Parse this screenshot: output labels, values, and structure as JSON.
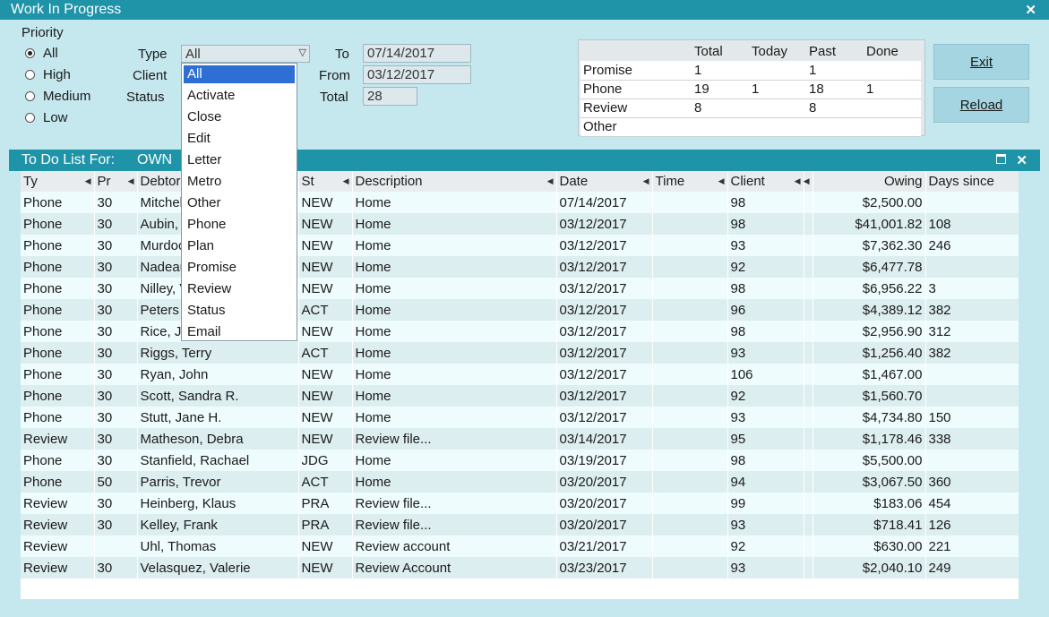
{
  "window": {
    "title": "Work In Progress",
    "close": "✕"
  },
  "filters": {
    "priority_label": "Priority",
    "priorities": [
      {
        "label": "All",
        "selected": true
      },
      {
        "label": "High",
        "selected": false
      },
      {
        "label": "Medium",
        "selected": false
      },
      {
        "label": "Low",
        "selected": false
      }
    ],
    "type_label": "Type",
    "type_value": "All",
    "client_label": "Client",
    "status_label": "Status",
    "to_label": "To",
    "to_value": "07/14/2017",
    "from_label": "From",
    "from_value": "03/12/2017",
    "total_label": "Total",
    "total_value": "28"
  },
  "type_dropdown": {
    "options": [
      "All",
      "Activate",
      "Close",
      "Edit",
      "Letter",
      "Metro",
      "Other",
      "Phone",
      "Plan",
      "Promise",
      "Review",
      "Status",
      "Email"
    ],
    "selected": "All"
  },
  "summary": {
    "headers": [
      "",
      "Total",
      "Today",
      "Past",
      "Done"
    ],
    "rows": [
      [
        "Promise",
        "1",
        "",
        "1",
        ""
      ],
      [
        "Phone",
        "19",
        "1",
        "18",
        "1"
      ],
      [
        "Review",
        "8",
        "",
        "8",
        ""
      ],
      [
        "Other",
        "",
        "",
        "",
        ""
      ]
    ]
  },
  "buttons": {
    "exit": "Exit",
    "reload": "Reload"
  },
  "todo": {
    "title": "To Do List For:",
    "owner": "OWN",
    "columns": [
      "Ty",
      "Pr",
      "Debtor",
      "St",
      "Description",
      "Date",
      "Time",
      "Client",
      "",
      "Owing",
      "Days since"
    ],
    "rows": [
      [
        "Phone",
        "30",
        "Mitchell",
        "NEW",
        "Home",
        "07/14/2017",
        "",
        "98",
        "",
        "$2,500.00",
        ""
      ],
      [
        "Phone",
        "30",
        "Aubin,",
        "NEW",
        "Home",
        "03/12/2017",
        "",
        "98",
        "",
        "$41,001.82",
        "108"
      ],
      [
        "Phone",
        "30",
        "Murdock",
        "NEW",
        "Home",
        "03/12/2017",
        "",
        "93",
        "",
        "$7,362.30",
        "246"
      ],
      [
        "Phone",
        "30",
        "Nadeau",
        "NEW",
        "Home",
        "03/12/2017",
        "",
        "92",
        "",
        "$6,477.78",
        ""
      ],
      [
        "Phone",
        "30",
        "Nilley, V",
        "NEW",
        "Home",
        "03/12/2017",
        "",
        "98",
        "",
        "$6,956.22",
        "3"
      ],
      [
        "Phone",
        "30",
        "Peters",
        "ACT",
        "Home",
        "03/12/2017",
        "",
        "96",
        "",
        "$4,389.12",
        "382"
      ],
      [
        "Phone",
        "30",
        "Rice, J",
        "NEW",
        "Home",
        "03/12/2017",
        "",
        "98",
        "",
        "$2,956.90",
        "312"
      ],
      [
        "Phone",
        "30",
        "Riggs, Terry",
        "ACT",
        "Home",
        "03/12/2017",
        "",
        "93",
        "",
        "$1,256.40",
        "382"
      ],
      [
        "Phone",
        "30",
        "Ryan, John",
        "NEW",
        "Home",
        "03/12/2017",
        "",
        "106",
        "",
        "$1,467.00",
        ""
      ],
      [
        "Phone",
        "30",
        "Scott, Sandra R.",
        "NEW",
        "Home",
        "03/12/2017",
        "",
        "92",
        "",
        "$1,560.70",
        ""
      ],
      [
        "Phone",
        "30",
        "Stutt, Jane H.",
        "NEW",
        "Home",
        "03/12/2017",
        "",
        "93",
        "",
        "$4,734.80",
        "150"
      ],
      [
        "Review",
        "30",
        "Matheson, Debra",
        "NEW",
        "Review file...",
        "03/14/2017",
        "",
        "95",
        "",
        "$1,178.46",
        "338"
      ],
      [
        "Phone",
        "30",
        "Stanfield, Rachael",
        "JDG",
        "Home",
        "03/19/2017",
        "",
        "98",
        "",
        "$5,500.00",
        ""
      ],
      [
        "Phone",
        "50",
        "Parris, Trevor",
        "ACT",
        "Home",
        "03/20/2017",
        "",
        "94",
        "",
        "$3,067.50",
        "360"
      ],
      [
        "Review",
        "30",
        "Heinberg, Klaus",
        "PRA",
        "Review file...",
        "03/20/2017",
        "",
        "99",
        "",
        "$183.06",
        "454"
      ],
      [
        "Review",
        "30",
        "Kelley, Frank",
        "PRA",
        "Review file...",
        "03/20/2017",
        "",
        "93",
        "",
        "$718.41",
        "126"
      ],
      [
        "Review",
        "",
        "Uhl, Thomas",
        "NEW",
        "Review account",
        "03/21/2017",
        "",
        "92",
        "",
        "$630.00",
        "221"
      ],
      [
        "Review",
        "30",
        "Velasquez, Valerie",
        "NEW",
        "Review Account",
        "03/23/2017",
        "",
        "93",
        "",
        "$2,040.10",
        "249"
      ]
    ]
  }
}
